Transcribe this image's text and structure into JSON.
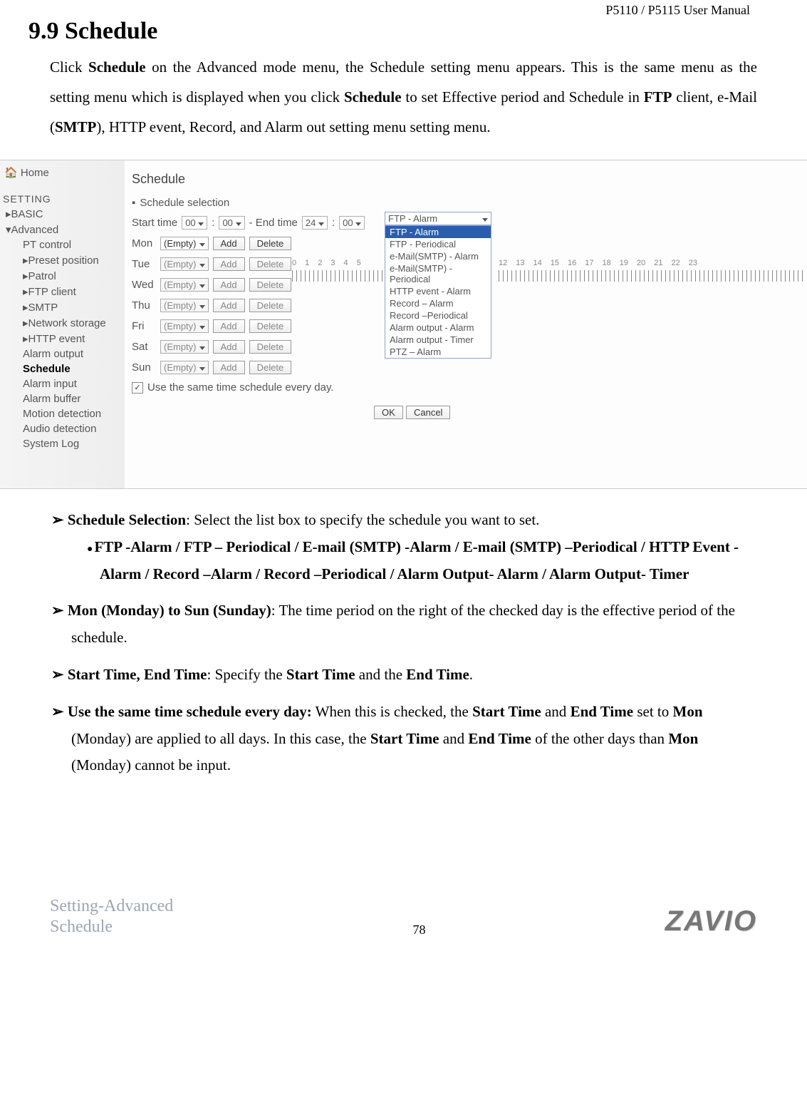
{
  "header": {
    "manual": "P5110 / P5115 User Manual"
  },
  "section": {
    "number": "9.9",
    "title": "Schedule",
    "intro_parts": [
      "Click ",
      " on the Advanced mode menu, the Schedule setting menu appears. This is the same menu as the setting menu which is displayed when you click ",
      " to set Effective period and Schedule in ",
      " client, e-Mail (",
      "), HTTP event, Record, and Alarm out setting menu setting menu."
    ],
    "intro_bold": {
      "b1": "Schedule",
      "b2": "Schedule",
      "b3": "FTP",
      "b4": "SMTP"
    }
  },
  "screenshot": {
    "home": "Home",
    "setting": "SETTING",
    "tree": {
      "basic": "BASIC",
      "advanced": "Advanced",
      "items": [
        "PT control",
        "Preset position",
        "Patrol",
        "FTP client",
        "SMTP",
        "Network storage",
        "HTTP event",
        "Alarm output",
        "Schedule",
        "Alarm input",
        "Alarm buffer",
        "Motion detection",
        "Audio detection",
        "System Log"
      ],
      "selected": "Schedule"
    },
    "main": {
      "title": "Schedule",
      "subsection": "Schedule selection",
      "start_label": "Start time",
      "end_label": "- End time",
      "time_vals": {
        "h1": "00",
        "m1": "00",
        "h2": "24",
        "m2": "00"
      },
      "days": [
        "Mon",
        "Tue",
        "Wed",
        "Thu",
        "Fri",
        "Sat",
        "Sun"
      ],
      "empty": "(Empty)",
      "add": "Add",
      "delete": "Delete",
      "same_day": "Use the same time schedule every day.",
      "ok": "OK",
      "cancel": "Cancel",
      "ruler1": [
        "0",
        "1",
        "2",
        "3",
        "4",
        "5"
      ],
      "ruler2": [
        "12",
        "13",
        "14",
        "15",
        "16",
        "17",
        "18",
        "19",
        "20",
        "21",
        "22",
        "23"
      ]
    },
    "dropdown": {
      "selected": "FTP - Alarm",
      "items": [
        "FTP - Alarm",
        "FTP - Periodical",
        "e-Mail(SMTP) - Alarm",
        "e-Mail(SMTP) - Periodical",
        "HTTP event - Alarm",
        "Record – Alarm",
        "Record –Periodical",
        "Alarm output - Alarm",
        "Alarm output - Timer",
        "PTZ – Alarm"
      ]
    }
  },
  "bullets": {
    "b1_title": "Schedule Selection",
    "b1_text": ": Select the list box to specify the schedule you want to set.",
    "b1_sub": "FTP -Alarm / FTP – Periodical / E-mail (SMTP) -Alarm / E-mail (SMTP)   –Periodical / HTTP Event -Alarm / Record –Alarm / Record –Periodical / Alarm Output- Alarm / Alarm Output- Timer",
    "b2_title": "Mon (Monday) to Sun (Sunday)",
    "b2_text": ": The time period on the right of the checked day is the effective period of the schedule.",
    "b3_title": "Start Time, End Time",
    "b3_text_a": ": Specify the ",
    "b3_b1": "Start Time",
    "b3_mid": " and the ",
    "b3_b2": "End Time",
    "b3_end": ".",
    "b4_title": "Use the same time schedule every day:",
    "b4_text_a": " When this is checked, the ",
    "b4_b1": "Start Time",
    "b4_mid1": " and ",
    "b4_b2": "End Time",
    "b4_mid2": " set to ",
    "b4_b3": "Mon",
    "b4_text_b": " (Monday) are applied to all days. In this case, the ",
    "b4_b4": "Start Time",
    "b4_mid3": " and ",
    "b4_b5": "End Time",
    "b4_text_c": " of the other days than ",
    "b4_b6": "Mon",
    "b4_text_d": " (Monday) cannot be input."
  },
  "footer": {
    "left1": "Setting-Advanced",
    "left2": "Schedule",
    "page": "78",
    "logo": "ZAVIO"
  }
}
